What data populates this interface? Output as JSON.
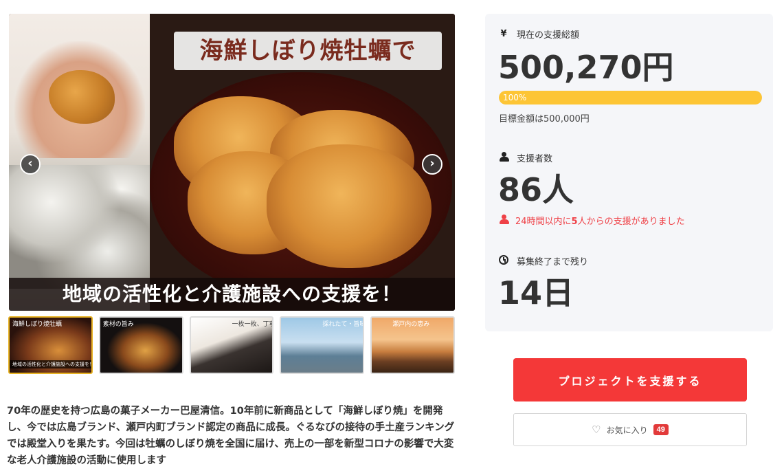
{
  "gallery": {
    "title_overlay": "海鮮しぼり焼牡蠣で",
    "bottom_overlay": "地域の活性化と介護施設への支援を！",
    "prev_label": "‹",
    "next_label": "›",
    "thumbnails": [
      {
        "caption": "海鮮しぼり焼牡蠣",
        "footer": "地域の活性化と介護施設への支援を！"
      },
      {
        "caption": "素材の旨み"
      },
      {
        "caption": "一枚一枚、丁寧に"
      },
      {
        "caption": "採れたて・旨味"
      },
      {
        "caption": "瀬戸内の恵み"
      }
    ]
  },
  "description": "70年の歴史を持つ広島の菓子メーカー巴屋清信。10年前に新商品として「海鮮しぼり焼」を開発し、今では広島ブランド、瀬戸内町ブランド認定の商品に成長。ぐるなびの接待の手土産ランキングでは殿堂入りを果たす。今回は牡蠣のしぼり焼を全国に届け、売上の一部を新型コロナの影響で大変な老人介護施設の活動に使用します",
  "stats": {
    "total": {
      "icon": "yen-icon",
      "icon_glyph": "¥",
      "label": "現在の支援総額",
      "value": "500,270円"
    },
    "progress": {
      "percent": 100,
      "label": "100%"
    },
    "goal": "目標金額は500,000円",
    "backers": {
      "icon": "users-icon",
      "label": "支援者数",
      "value": "86人"
    },
    "recent": {
      "prefix": "24時間以内に",
      "count": "5",
      "suffix": "人からの支援がありました"
    },
    "remaining": {
      "icon": "clock-icon",
      "label": "募集終了まで残り",
      "value": "14日"
    }
  },
  "actions": {
    "support_label": "プロジェクトを支援する",
    "favorite_label": "お気に入り",
    "favorite_count": "49"
  },
  "colors": {
    "accent_red": "#f43838",
    "progress_yellow": "#fdc535",
    "recent_red": "#ef4147",
    "panel_bg": "#f5f6f9"
  }
}
